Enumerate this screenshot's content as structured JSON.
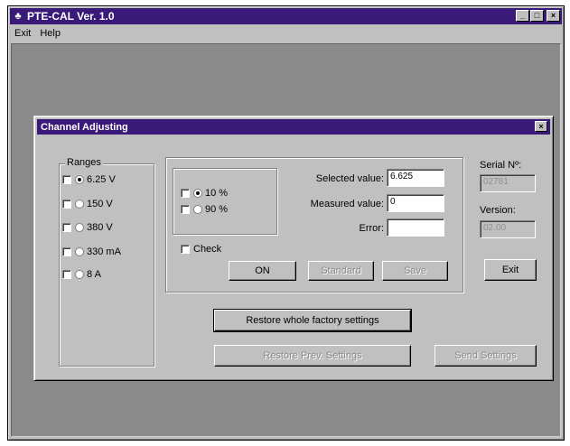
{
  "window": {
    "title": "PTE-CAL  Ver. 1.0",
    "controls": [
      "_",
      "□",
      "×"
    ]
  },
  "menu": {
    "items": [
      "Exit",
      "Help"
    ]
  },
  "dialog": {
    "title": "Channel Adjusting",
    "close": "×",
    "ranges": {
      "label": "Ranges",
      "items": [
        {
          "label": "6.25 V",
          "selected": true
        },
        {
          "label": "150 V",
          "selected": false
        },
        {
          "label": "380 V",
          "selected": false
        },
        {
          "label": "330 mA",
          "selected": false
        },
        {
          "label": "8 A",
          "selected": false
        }
      ]
    },
    "percent": [
      {
        "label": "10 %",
        "selected": true
      },
      {
        "label": "90 %",
        "selected": false
      }
    ],
    "fields": {
      "selected_label": "Selected value:",
      "selected_value": "6.625",
      "measured_label": "Measured value:",
      "measured_value": "0",
      "error_label": "Error:",
      "error_value": ""
    },
    "check_label": "Check",
    "buttons": {
      "on": "ON",
      "standard": "Standard",
      "save": "Save",
      "exit": "Exit",
      "restore_factory": "Restore whole factory settings",
      "restore_prev": "Restore Prev. Settings",
      "send": "Send Settings"
    },
    "serial": {
      "label": "Serial Nº:",
      "value": "02781"
    },
    "version": {
      "label": "Version:",
      "value": "02.00"
    }
  }
}
